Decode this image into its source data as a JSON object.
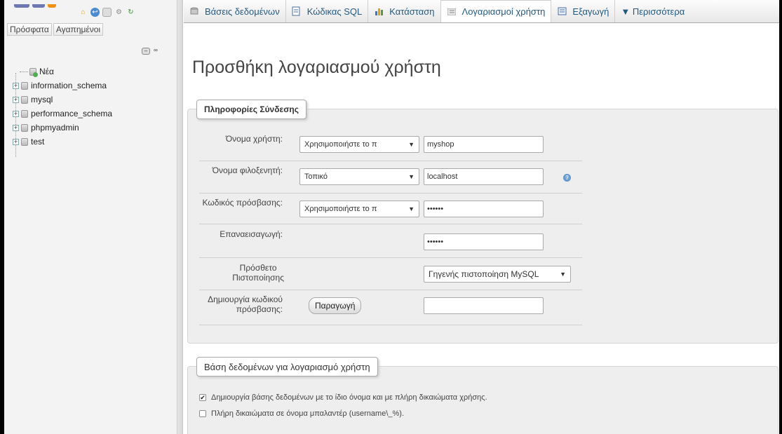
{
  "sidebar": {
    "tabs": [
      "Πρόσφατα",
      "Αγαπημένοι"
    ],
    "tree": [
      {
        "label": "Νέα"
      },
      {
        "label": "information_schema"
      },
      {
        "label": "mysql"
      },
      {
        "label": "performance_schema"
      },
      {
        "label": "phpmyadmin"
      },
      {
        "label": "test"
      }
    ]
  },
  "topmenu": {
    "tabs": [
      {
        "label": "Βάσεις δεδομένων"
      },
      {
        "label": "Κώδικας SQL"
      },
      {
        "label": "Κατάσταση"
      },
      {
        "label": "Λογαριασμοί χρήστη"
      },
      {
        "label": "Εξαγωγή"
      },
      {
        "label": "▼ Περισσότερα"
      }
    ]
  },
  "main": {
    "title": "Προσθήκη λογαριασμού χρήστη",
    "login": {
      "legend": "Πληροφορίες Σύνδεσης",
      "username_label": "Όνομα χρήστη:",
      "username_select": "Χρησιμοποιήστε το π",
      "username_value": "myshop",
      "host_label": "Όνομα φιλοξενητή:",
      "host_select": "Τοπικό",
      "host_value": "localhost",
      "password_label": "Κωδικός πρόσβασης:",
      "password_select": "Χρησιμοποιήστε το π",
      "password_value": "••••••",
      "retype_label": "Επαναεισαγωγή:",
      "retype_value": "••••••",
      "auth_label_line1": "Πρόσθετο",
      "auth_label_line2": "Πιστοποίησης",
      "auth_select": "Γηγενής πιστοποίηση MySQL",
      "generate_label_line1": "Δημιουργία κωδικού",
      "generate_label_line2": "πρόσβασης:",
      "generate_button": "Παραγωγή",
      "generate_value": ""
    },
    "database": {
      "legend": "Βάση δεδομένων για λογαριασμό χρήστη",
      "option1": "Δημιουργία βάσης δεδομένων με το ίδιο όνομα και με πλήρη δικαιώματα χρήσης.",
      "option1_checked": true,
      "option2": "Πλήρη δικαιώματα σε όνομα μπαλαντέρ (username\\_%).",
      "option2_checked": false
    }
  },
  "colors": {
    "link": "#235a81",
    "panel": "#eeeeee",
    "sidebar": "#f3f3f3"
  }
}
